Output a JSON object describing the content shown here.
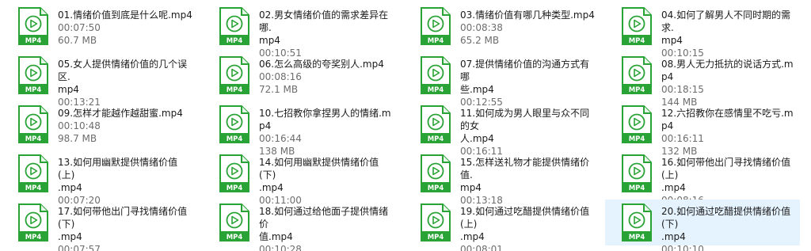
{
  "icon_badge": "MP4",
  "colors": {
    "icon_green": "#2aa336",
    "selected_bg": "#e5f3ff",
    "meta_text": "#6d6d6d"
  },
  "files": [
    {
      "name_lines": [
        "01.情绪价值到底是什么呢.mp4"
      ],
      "duration": "00:07:50",
      "size": "60.7 MB"
    },
    {
      "name_lines": [
        "02.男女情绪价值的需求差异在哪.",
        "mp4"
      ],
      "duration": "00:10:51"
    },
    {
      "name_lines": [
        "03.情绪价值有哪几种类型.mp4"
      ],
      "duration": "00:08:38",
      "size": "65.2 MB"
    },
    {
      "name_lines": [
        "04.如何了解男人不同时期的需求.",
        "mp4"
      ],
      "duration": "00:10:15"
    },
    {
      "name_lines": [
        "05.女人提供情绪价值的几个误区.",
        "mp4"
      ],
      "duration": "00:13:21"
    },
    {
      "name_lines": [
        "06.怎么高级的夸奖别人.mp4"
      ],
      "duration": "00:08:16",
      "size": "72.1 MB"
    },
    {
      "name_lines": [
        "07.提供情绪价值的沟通方式有哪",
        "些.mp4"
      ],
      "duration": "00:12:55"
    },
    {
      "name_lines": [
        "08.男人无力抵抗的说话方式.mp4"
      ],
      "duration": "00:18:15",
      "size": "144 MB"
    },
    {
      "name_lines": [
        "09.怎样才能越作越甜蜜.mp4"
      ],
      "duration": "00:10:48",
      "size": "98.7 MB"
    },
    {
      "name_lines": [
        "10.七招教你拿捏男人的情绪.mp4"
      ],
      "duration": "00:16:44",
      "size": "138 MB"
    },
    {
      "name_lines": [
        "11.如何成为男人眼里与众不同的女",
        "人.mp4"
      ],
      "duration": "00:16:11"
    },
    {
      "name_lines": [
        "12.六招教你在感情里不吃亏.mp4"
      ],
      "duration": "00:16:11",
      "size": "132 MB"
    },
    {
      "name_lines": [
        "13.如何用幽默提供情绪价值(上)",
        ".mp4"
      ],
      "duration": "00:07:20"
    },
    {
      "name_lines": [
        "14.如何用幽默提供情绪价值(下)",
        ".mp4"
      ],
      "duration": "00:11:00"
    },
    {
      "name_lines": [
        "15.怎样送礼物才能提供情绪价值.",
        "mp4"
      ],
      "duration": "00:13:18"
    },
    {
      "name_lines": [
        "16.如何带他出门寻找情绪价值(上)",
        ".mp4"
      ],
      "duration": "00:08:16"
    },
    {
      "name_lines": [
        "17.如何带他出门寻找情绪价值(下)",
        ".mp4"
      ],
      "duration": "00:07:57"
    },
    {
      "name_lines": [
        "18.如何通过给他面子提供情绪价",
        "值.mp4"
      ],
      "duration": "00:10:28"
    },
    {
      "name_lines": [
        "19.如何通过吃醋提供情绪价值(上)",
        ".mp4"
      ],
      "duration": "00:08:01"
    },
    {
      "name_lines": [
        "20.如何通过吃醋提供情绪价值(下)",
        ".mp4"
      ],
      "duration": "00:10:10",
      "selected": true
    }
  ]
}
